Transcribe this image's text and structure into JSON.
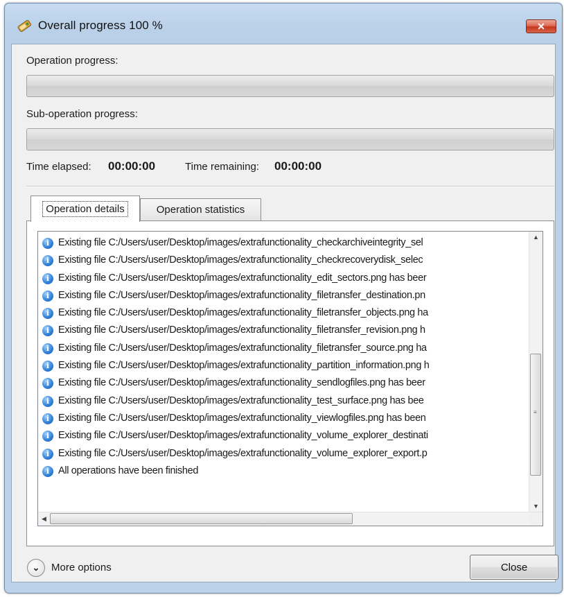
{
  "window": {
    "title": "Overall progress 100 %",
    "title_icon": "progress-app-icon",
    "close_glyph": "✕"
  },
  "progress": {
    "operation_label": "Operation progress:",
    "operation_value": 0,
    "sub_operation_label": "Sub-operation progress:",
    "sub_operation_value": 0
  },
  "time": {
    "elapsed_label": "Time elapsed:",
    "elapsed_value": "00:00:00",
    "remaining_label": "Time remaining:",
    "remaining_value": "00:00:00"
  },
  "tabs": [
    {
      "label": "Operation details",
      "active": true
    },
    {
      "label": "Operation statistics",
      "active": false
    }
  ],
  "log": {
    "icon": "info-icon",
    "info_glyph": "i",
    "lines": [
      "Existing file C:/Users/user/Desktop/images/extrafunctionality_checkarchiveintegrity_sel",
      "Existing file C:/Users/user/Desktop/images/extrafunctionality_checkrecoverydisk_selec",
      "Existing file C:/Users/user/Desktop/images/extrafunctionality_edit_sectors.png has beer",
      "Existing file C:/Users/user/Desktop/images/extrafunctionality_filetransfer_destination.pn",
      "Existing file C:/Users/user/Desktop/images/extrafunctionality_filetransfer_objects.png ha",
      "Existing file C:/Users/user/Desktop/images/extrafunctionality_filetransfer_revision.png h",
      "Existing file C:/Users/user/Desktop/images/extrafunctionality_filetransfer_source.png ha",
      "Existing file C:/Users/user/Desktop/images/extrafunctionality_partition_information.png h",
      "Existing file C:/Users/user/Desktop/images/extrafunctionality_sendlogfiles.png has beer",
      "Existing file C:/Users/user/Desktop/images/extrafunctionality_test_surface.png has bee",
      "Existing file C:/Users/user/Desktop/images/extrafunctionality_viewlogfiles.png has been",
      "Existing file C:/Users/user/Desktop/images/extrafunctionality_volume_explorer_destinati",
      "Existing file C:/Users/user/Desktop/images/extrafunctionality_volume_explorer_export.p",
      "All operations have been finished"
    ]
  },
  "scroll": {
    "up_glyph": "▲",
    "down_glyph": "▼",
    "left_glyph": "◀",
    "right_glyph": "▶",
    "grip_glyph": "≡"
  },
  "footer": {
    "more_options_glyph": "⌄",
    "more_options_label": "More options",
    "close_label": "Close"
  }
}
